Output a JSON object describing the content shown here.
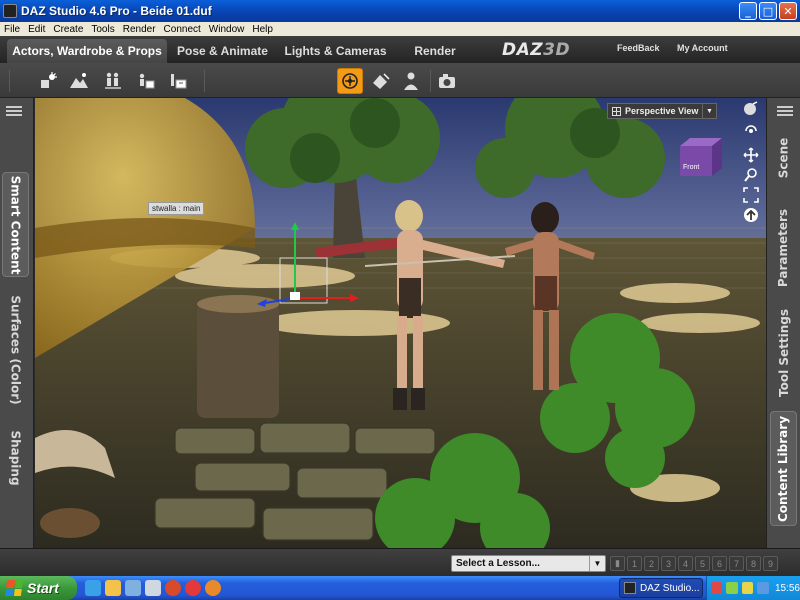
{
  "window": {
    "title": "DAZ Studio 4.6 Pro - Beide 01.duf",
    "buttons": [
      "minimize",
      "maximize",
      "close"
    ]
  },
  "menubar": [
    "File",
    "Edit",
    "Create",
    "Tools",
    "Render",
    "Connect",
    "Window",
    "Help"
  ],
  "tabs": [
    {
      "label": "Actors, Wardrobe & Props",
      "active": true
    },
    {
      "label": "Pose & Animate",
      "active": false
    },
    {
      "label": "Lights & Cameras",
      "active": false
    },
    {
      "label": "Render",
      "active": false
    }
  ],
  "brand": {
    "logo_daz": "DAZ",
    "logo_3d": "3D",
    "feedback": "FeedBack",
    "account": "My Account"
  },
  "toolbar": {
    "icons": [
      "add-light-icon",
      "terrain-icon",
      "figure-group-icon",
      "content-add-icon",
      "content-load-icon",
      "universal-tool-icon",
      "node-select-icon",
      "figure-pose-icon",
      "render-camera-icon"
    ],
    "active_icon": "universal-tool-icon",
    "accent": "#f39a17"
  },
  "left_tabs": [
    {
      "label": "Smart Content",
      "active": true
    },
    {
      "label": "Surfaces (Color)",
      "active": false
    },
    {
      "label": "Shaping",
      "active": false
    }
  ],
  "right_tabs": [
    {
      "label": "Scene",
      "active": false
    },
    {
      "label": "Parameters",
      "active": false
    },
    {
      "label": "Tool Settings",
      "active": false
    },
    {
      "label": "Content Library",
      "active": true
    }
  ],
  "viewport": {
    "camera": "Perspective View",
    "tooltip": "stwalla : main",
    "cube_label": "Front",
    "nav_icons": [
      "rotate-icon",
      "move-icon",
      "zoom-icon",
      "frame-icon",
      "up-icon"
    ]
  },
  "statusbar": {
    "lesson_placeholder": "Select a Lesson...",
    "steps": [
      "1",
      "2",
      "3",
      "4",
      "5",
      "6",
      "7",
      "8",
      "9"
    ]
  },
  "taskbar": {
    "start": "Start",
    "task": "DAZ Studio...",
    "clock": "15:56"
  }
}
